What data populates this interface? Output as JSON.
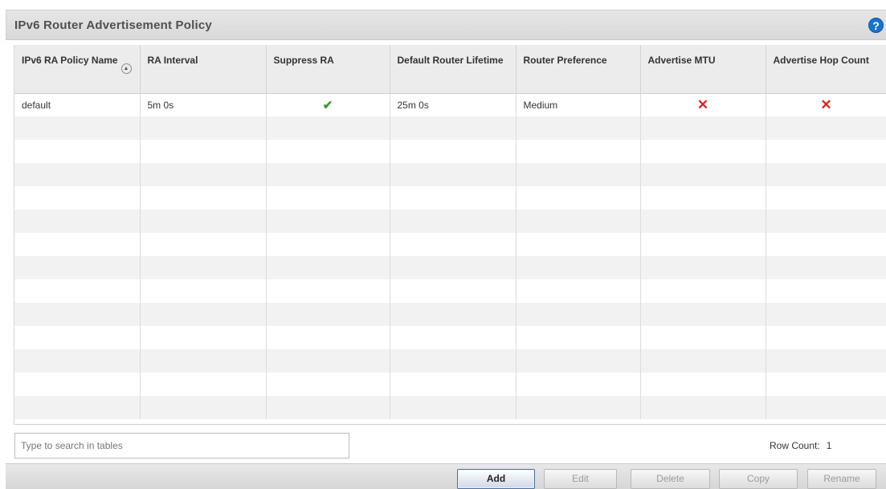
{
  "panel": {
    "title": "IPv6 Router Advertisement Policy",
    "help_icon": "?"
  },
  "table": {
    "columns": [
      "IPv6 RA Policy Name",
      "RA Interval",
      "Suppress RA",
      "Default Router Lifetime",
      "Router Preference",
      "Advertise MTU",
      "Advertise Hop Count"
    ],
    "rows": [
      {
        "name": "default",
        "ra_interval": "5m 0s",
        "suppress_ra": "✔",
        "default_router_lifetime": "25m 0s",
        "router_preference": "Medium",
        "advertise_mtu": "✕",
        "advertise_hop_count": "✕"
      }
    ]
  },
  "search": {
    "placeholder": "Type to search in tables"
  },
  "row_count": {
    "label": "Row Count:",
    "value": "1"
  },
  "buttons": {
    "add": "Add",
    "edit": "Edit",
    "delete": "Delete",
    "copy": "Copy",
    "rename": "Rename"
  },
  "colors": {
    "check": "#3a9a2c",
    "cross": "#e02020",
    "help": "#1a73c9"
  }
}
